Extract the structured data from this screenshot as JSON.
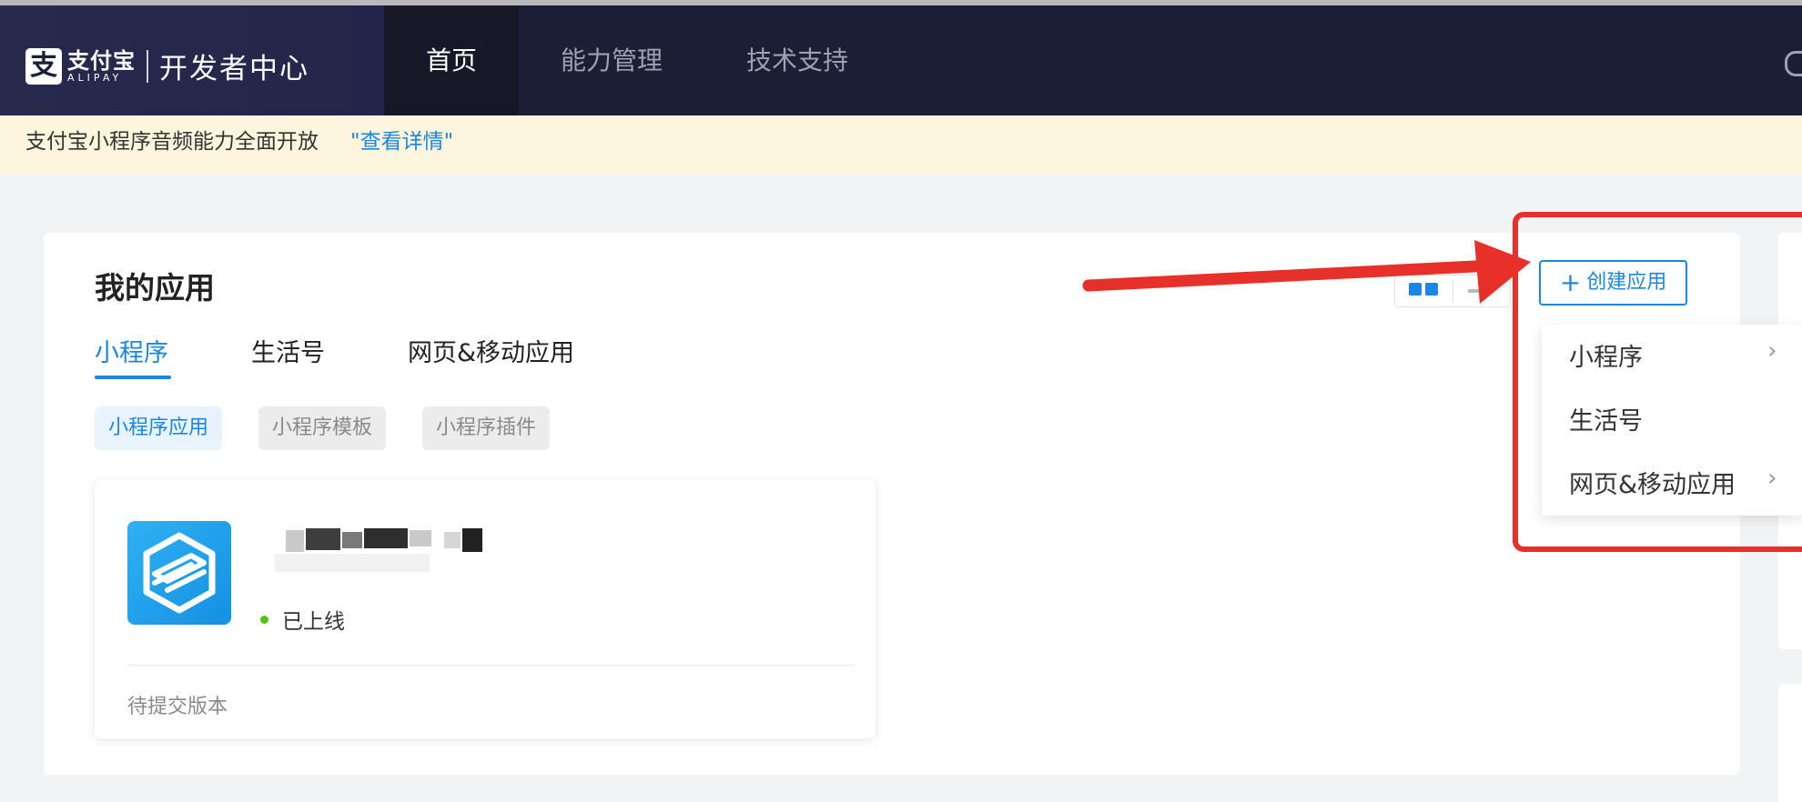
{
  "header": {
    "logo": {
      "cn": "支付宝",
      "en": "ALIPAY",
      "badge": "支"
    },
    "title": "开发者中心",
    "nav": [
      {
        "label": "首页",
        "active": true
      },
      {
        "label": "能力管理",
        "active": false
      },
      {
        "label": "技术支持",
        "active": false
      }
    ]
  },
  "notice": {
    "text": "支付宝小程序音频能力全面开放",
    "link": "\"查看详情\""
  },
  "main": {
    "title": "我的应用",
    "tabs": [
      {
        "label": "小程序",
        "active": true
      },
      {
        "label": "生活号",
        "active": false
      },
      {
        "label": "网页&移动应用",
        "active": false
      }
    ],
    "subtabs": [
      {
        "label": "小程序应用",
        "active": true
      },
      {
        "label": "小程序模板",
        "active": false
      },
      {
        "label": "小程序插件",
        "active": false
      }
    ],
    "app": {
      "status": "已上线",
      "version_status": "待提交版本"
    }
  },
  "create": {
    "label": "创建应用",
    "menu": [
      {
        "label": "小程序",
        "has_submenu": true
      },
      {
        "label": "生活号",
        "has_submenu": false
      },
      {
        "label": "网页&移动应用",
        "has_submenu": true
      }
    ]
  },
  "colors": {
    "header_bg": "#1c1e36",
    "accent": "#1b86e3",
    "notice_bg": "#fef5dd",
    "annotation_red": "#e8302a",
    "status_green": "#52c41a"
  }
}
